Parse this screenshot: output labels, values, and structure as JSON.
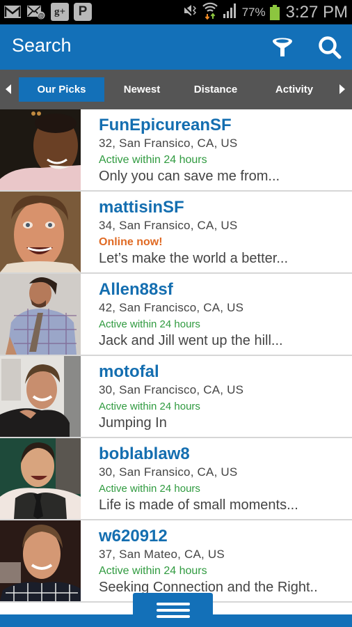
{
  "status_bar": {
    "notifications": [
      {
        "icon": "gmail-icon"
      },
      {
        "icon": "email-icon"
      },
      {
        "icon": "google-plus-icon",
        "label": "g+"
      },
      {
        "icon": "pinterest-icon",
        "label": "P"
      }
    ],
    "battery_percent": "77%",
    "time": "3:27 PM",
    "battery_color": "#8cc63f"
  },
  "app_bar": {
    "title": "Search",
    "actions": [
      {
        "icon": "filter-icon",
        "label": "Filter"
      },
      {
        "icon": "search-icon",
        "label": "Search"
      }
    ],
    "color": "#1370b8"
  },
  "tabs": {
    "items": [
      {
        "label": "Our Picks",
        "active": true
      },
      {
        "label": "Newest",
        "active": false
      },
      {
        "label": "Distance",
        "active": false
      },
      {
        "label": "Activity",
        "active": false
      }
    ]
  },
  "profiles": [
    {
      "username": "FunEpicureanSF",
      "location": "32, San Fransico, CA, US",
      "status": "Active within 24 hours",
      "about": "Only you can save me from..."
    },
    {
      "username": "mattisinSF",
      "location": "34, San Fransico, CA, US",
      "status": "Online now!",
      "about": "Let’s make the world a better..."
    },
    {
      "username": "Allen88sf",
      "location": "42, San Francisco, CA, US",
      "status": "Active within 24 hours",
      "about": "Jack and Jill went up the hill..."
    },
    {
      "username": "motofal",
      "location": "30, San Francisco, CA, US",
      "status": "Active within 24 hours",
      "about": "Jumping In"
    },
    {
      "username": "boblablaw8",
      "location": "30, San Fransico, CA, US",
      "status": "Active within 24 hours",
      "about": "Life is made of small moments..."
    },
    {
      "username": "w620912",
      "location": "37, San Mateo, CA, US",
      "status": "Active within 24 hours",
      "about": "Seeking Connection and the Right.."
    }
  ],
  "colors": {
    "username": "#146eb0",
    "active_status": "#2f9a3f",
    "online_status": "#e06a24"
  },
  "bottom": {
    "menu_icon": "hamburger-menu-icon"
  }
}
